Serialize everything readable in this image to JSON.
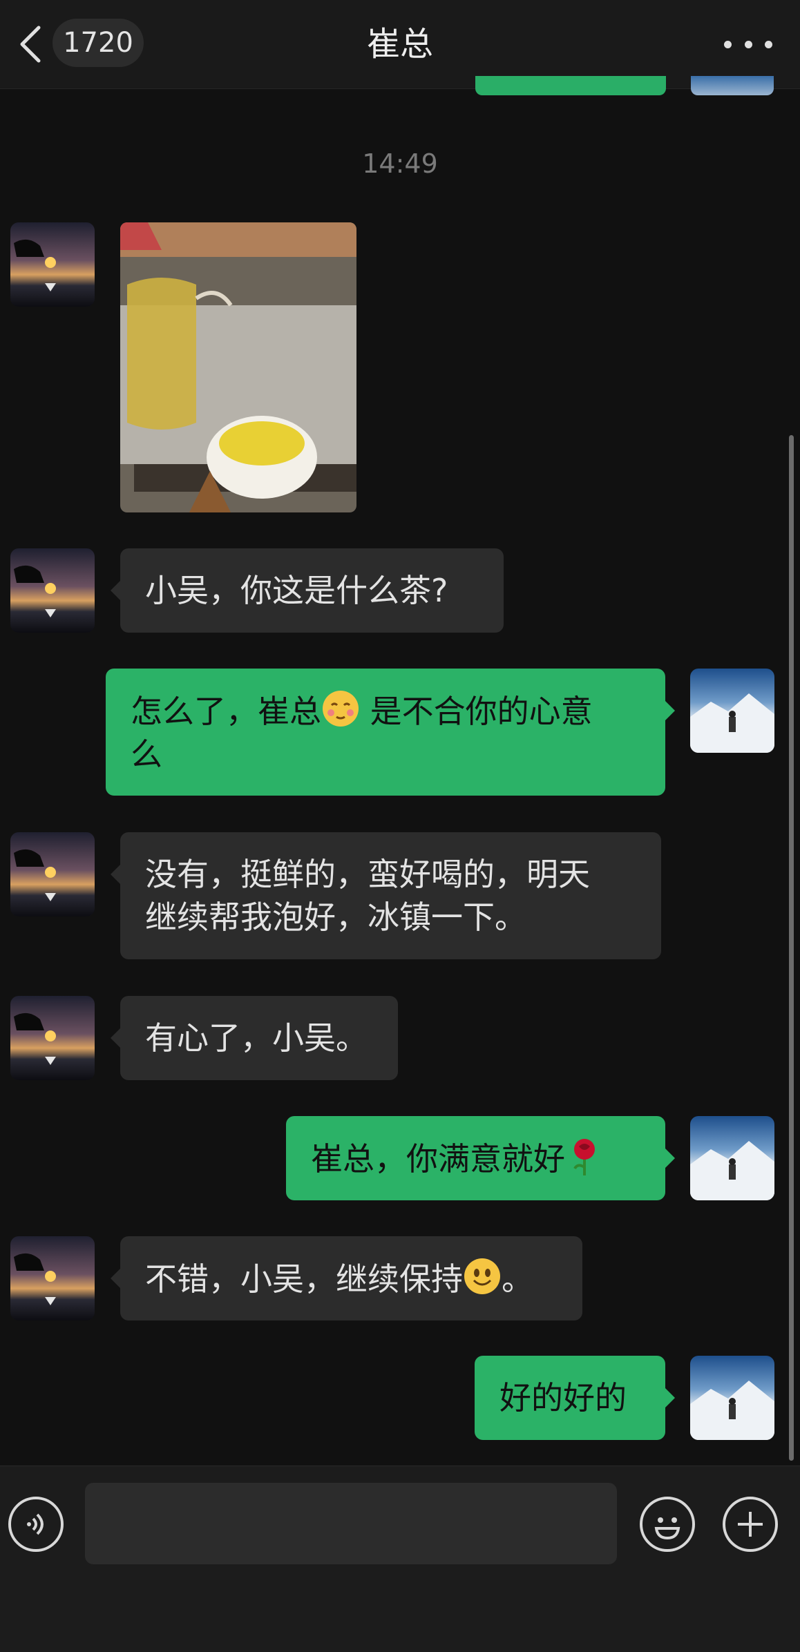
{
  "header": {
    "back_label": "back",
    "unread_count": "1720",
    "title": "崔总",
    "more_icon": "more-dots-icon"
  },
  "timestamp": "14:49",
  "messages": [
    {
      "side": "in",
      "type": "image",
      "description_icon": "tea-photo"
    },
    {
      "side": "in",
      "type": "text",
      "parts": [
        "小吴，你这是什么茶?"
      ]
    },
    {
      "side": "out",
      "type": "text",
      "line1_a": "怎么了，崔总",
      "line1_emoji": "blush-face-emoji",
      "line1_b": " 是不合你的心意",
      "line2": "么"
    },
    {
      "side": "in",
      "type": "text",
      "line1": "没有，挺鲜的，蛮好喝的，明天",
      "line2": "继续帮我泡好，冰镇一下。"
    },
    {
      "side": "in",
      "type": "text",
      "parts": [
        "有心了，小吴。"
      ]
    },
    {
      "side": "out",
      "type": "text",
      "text": "崔总，你满意就好",
      "emoji": "rose-emoji"
    },
    {
      "side": "in",
      "type": "text",
      "text_a": "不错，小吴，继续保持",
      "emoji": "smile-face-emoji",
      "text_b": "。"
    },
    {
      "side": "out",
      "type": "text",
      "parts": [
        "好的好的"
      ]
    }
  ],
  "input_bar": {
    "voice_icon": "voice-icon",
    "input_value": "",
    "emoji_icon": "emoji-icon",
    "plus_icon": "plus-icon"
  },
  "colors": {
    "background": "#111111",
    "header": "#1a1a1a",
    "incoming_bubble": "#2c2c2c",
    "outgoing_bubble": "#2bb267"
  }
}
